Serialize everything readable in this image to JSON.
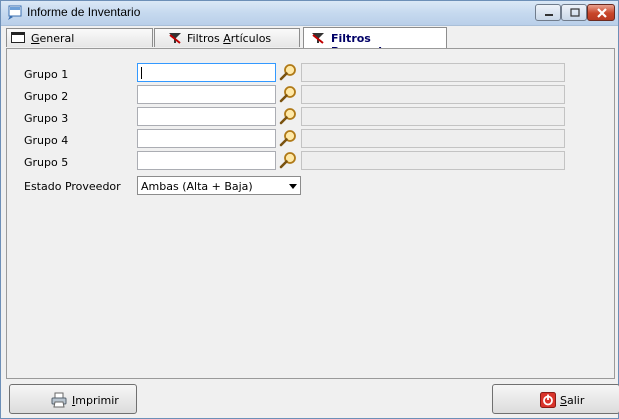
{
  "window": {
    "title": "Informe de Inventario"
  },
  "tabs": [
    {
      "label": "General",
      "mnemonic": "G",
      "rest": "eneral"
    },
    {
      "label": "Filtros Artículos",
      "prefix": "Filtros ",
      "mnemonic": "A",
      "rest": "rtículos"
    },
    {
      "label": "Filtros Proveedores",
      "prefix": "Filtros ",
      "mnemonic": "P",
      "rest": "roveedores"
    }
  ],
  "fields": {
    "grupo1": {
      "label": "Grupo 1",
      "value": "",
      "description": ""
    },
    "grupo2": {
      "label": "Grupo 2",
      "value": "",
      "description": ""
    },
    "grupo3": {
      "label": "Grupo 3",
      "value": "",
      "description": ""
    },
    "grupo4": {
      "label": "Grupo 4",
      "value": "",
      "description": ""
    },
    "grupo5": {
      "label": "Grupo 5",
      "value": "",
      "description": ""
    },
    "estado": {
      "label": "Estado Proveedor",
      "selected": "Ambas (Alta + Baja)"
    }
  },
  "buttons": {
    "print": {
      "mnemonic": "I",
      "rest": "mprimir"
    },
    "exit": {
      "mnemonic": "S",
      "rest": "alir"
    }
  },
  "colors": {
    "accent": "#000066",
    "focus_border": "#3399ff"
  }
}
